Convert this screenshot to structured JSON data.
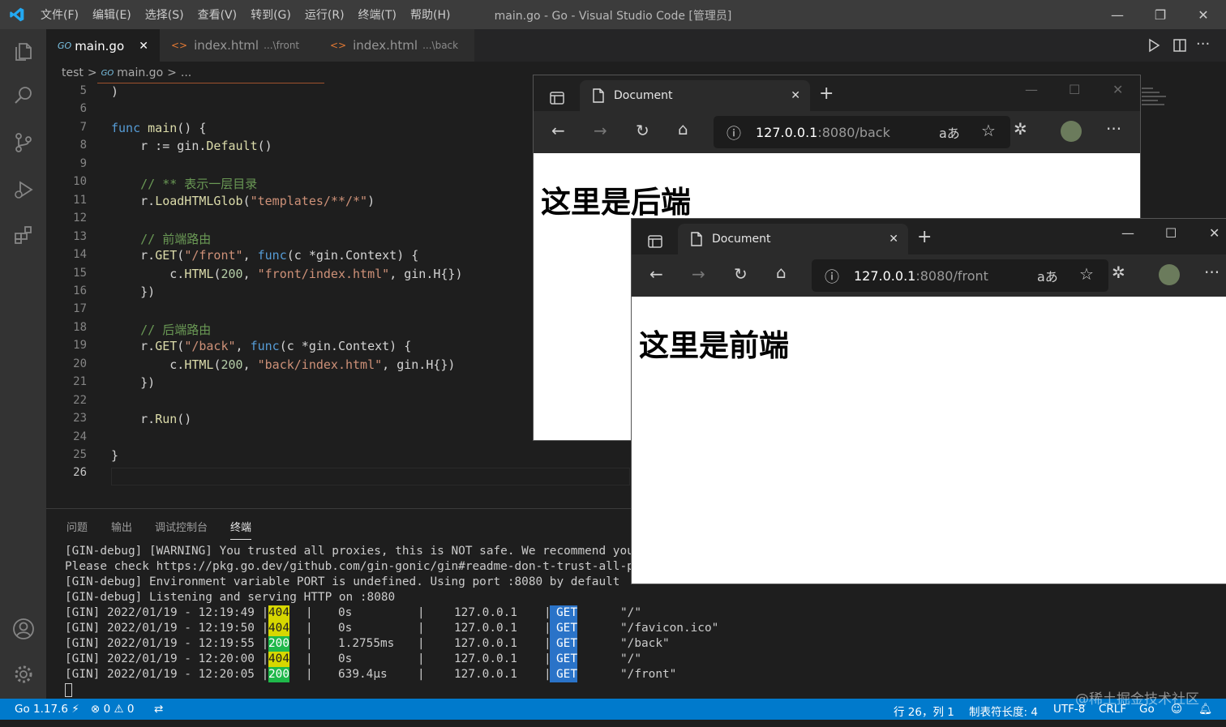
{
  "titlebar": {
    "title": "main.go - Go - Visual Studio Code [管理员]",
    "menu": [
      "文件(F)",
      "编辑(E)",
      "选择(S)",
      "查看(V)",
      "转到(G)",
      "运行(R)",
      "终端(T)",
      "帮助(H)"
    ],
    "minimize": "—",
    "restore": "❐",
    "close": "✕"
  },
  "tabs": [
    {
      "icon": "GO",
      "label": "main.go",
      "sub": "",
      "close": "✕"
    },
    {
      "icon": "<>",
      "label": "index.html",
      "sub": "...\\front"
    },
    {
      "icon": "<>",
      "label": "index.html",
      "sub": "...\\back"
    }
  ],
  "breadcrumb": {
    "folder": "test",
    "sep1": ">",
    "icon": "GO",
    "file": "main.go",
    "sep2": ">",
    "rest": "..."
  },
  "code": [
    {
      "n": "5",
      "text": ")"
    },
    {
      "n": "6",
      "text": ""
    },
    {
      "n": "7",
      "text": "func main() {"
    },
    {
      "n": "8",
      "text": "    r := gin.Default()"
    },
    {
      "n": "9",
      "text": ""
    },
    {
      "n": "10",
      "text": "    // ** 表示一层目录"
    },
    {
      "n": "11",
      "text": "    r.LoadHTMLGlob(\"templates/**/*\")"
    },
    {
      "n": "12",
      "text": ""
    },
    {
      "n": "13",
      "text": "    // 前端路由"
    },
    {
      "n": "14",
      "text": "    r.GET(\"/front\", func(c *gin.Context) {"
    },
    {
      "n": "15",
      "text": "        c.HTML(200, \"front/index.html\", gin.H{})"
    },
    {
      "n": "16",
      "text": "    })"
    },
    {
      "n": "17",
      "text": ""
    },
    {
      "n": "18",
      "text": "    // 后端路由"
    },
    {
      "n": "19",
      "text": "    r.GET(\"/back\", func(c *gin.Context) {"
    },
    {
      "n": "20",
      "text": "        c.HTML(200, \"back/index.html\", gin.H{})"
    },
    {
      "n": "21",
      "text": "    })"
    },
    {
      "n": "22",
      "text": ""
    },
    {
      "n": "23",
      "text": "    r.Run()"
    },
    {
      "n": "24",
      "text": ""
    },
    {
      "n": "25",
      "text": "}"
    },
    {
      "n": "26",
      "text": ""
    }
  ],
  "panel": {
    "tabs": [
      "问题",
      "输出",
      "调试控制台",
      "终端"
    ],
    "active": "终端",
    "lines": [
      "[GIN-debug] [WARNING] You trusted all proxies, this is NOT safe. We recommend you",
      "Please check https://pkg.go.dev/github.com/gin-gonic/gin#readme-don-t-trust-all-p",
      "[GIN-debug] Environment variable PORT is undefined. Using port :8080 by default",
      "[GIN-debug] Listening and serving HTTP on :8080"
    ],
    "requests": [
      {
        "prefix": "[GIN] 2022/01/19 - 12:19:49 |",
        "code": "404",
        "latency": "0s",
        "ip": "127.0.0.1",
        "method": "GET",
        "path": "\"/\""
      },
      {
        "prefix": "[GIN] 2022/01/19 - 12:19:50 |",
        "code": "404",
        "latency": "0s",
        "ip": "127.0.0.1",
        "method": "GET",
        "path": "\"/favicon.ico\""
      },
      {
        "prefix": "[GIN] 2022/01/19 - 12:19:55 |",
        "code": "200",
        "latency": "1.2755ms",
        "ip": "127.0.0.1",
        "method": "GET",
        "path": "\"/back\""
      },
      {
        "prefix": "[GIN] 2022/01/19 - 12:20:00 |",
        "code": "404",
        "latency": "0s",
        "ip": "127.0.0.1",
        "method": "GET",
        "path": "\"/\""
      },
      {
        "prefix": "[GIN] 2022/01/19 - 12:20:05 |",
        "code": "200",
        "latency": "639.4µs",
        "ip": "127.0.0.1",
        "method": "GET",
        "path": "\"/front\""
      }
    ]
  },
  "status": {
    "go": "Go 1.17.6",
    "errors": "0",
    "warnings": "0",
    "position": "行 26，列 1",
    "tabsize": "制表符长度: 4",
    "encoding": "UTF-8",
    "eol": "CRLF",
    "lang": "Go"
  },
  "browser_back": {
    "tab_title": "Document",
    "address_host": "127.0.0.1",
    "address_rest": ":8080/back",
    "heading": "这里是后端"
  },
  "browser_front": {
    "tab_title": "Document",
    "address_host": "127.0.0.1",
    "address_rest": ":8080/front",
    "heading": "这里是前端"
  },
  "watermark": "@稀土掘金技术社区",
  "icons": {
    "files": "files-icon",
    "search": "search-icon",
    "scm": "source-control-icon",
    "debug": "run-debug-icon",
    "ext": "extensions-icon",
    "account": "account-icon",
    "settings": "gear-icon"
  }
}
